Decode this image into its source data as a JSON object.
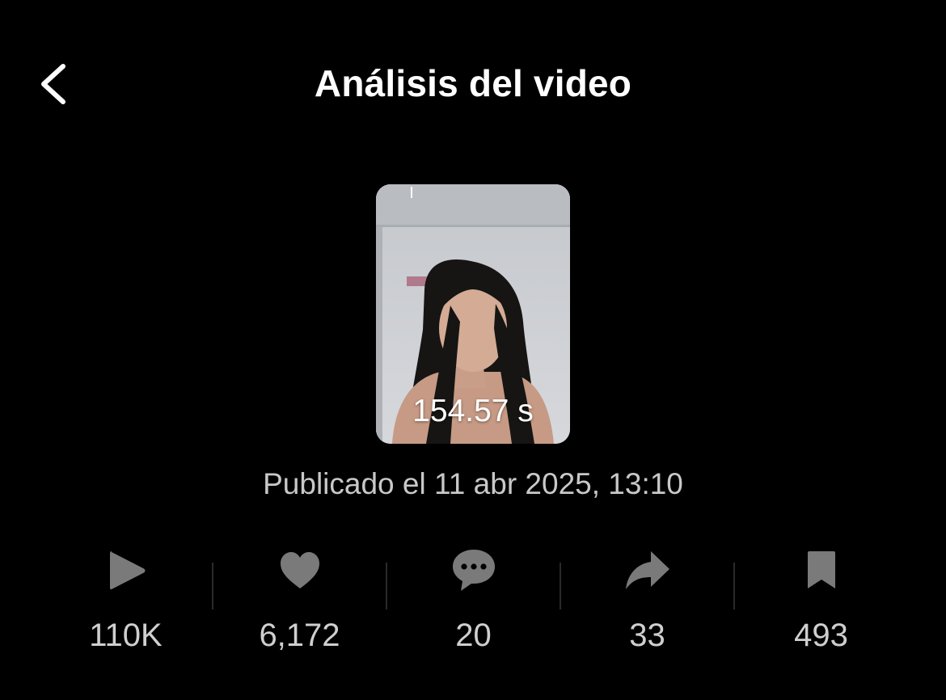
{
  "header": {
    "title": "Análisis del video",
    "back_icon": "chevron-left-icon"
  },
  "video": {
    "duration": "154.57 s",
    "published": "Publicado el 11 abr 2025, 13:10"
  },
  "stats": [
    {
      "icon": "play-icon",
      "value": "110K"
    },
    {
      "icon": "heart-icon",
      "value": "6,172"
    },
    {
      "icon": "comment-icon",
      "value": "20"
    },
    {
      "icon": "share-icon",
      "value": "33"
    },
    {
      "icon": "bookmark-icon",
      "value": "493"
    }
  ],
  "colors": {
    "background": "#000000",
    "title": "#ffffff",
    "muted_text": "#c8c8c8",
    "icon": "#7a7a7a"
  }
}
